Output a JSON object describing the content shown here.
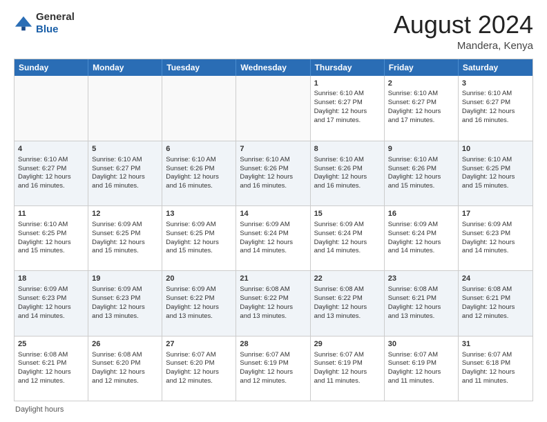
{
  "logo": {
    "general": "General",
    "blue": "Blue"
  },
  "title": "August 2024",
  "location": "Mandera, Kenya",
  "days": [
    "Sunday",
    "Monday",
    "Tuesday",
    "Wednesday",
    "Thursday",
    "Friday",
    "Saturday"
  ],
  "footer": "Daylight hours",
  "weeks": [
    [
      {
        "day": "",
        "content": ""
      },
      {
        "day": "",
        "content": ""
      },
      {
        "day": "",
        "content": ""
      },
      {
        "day": "",
        "content": ""
      },
      {
        "day": "1",
        "content": "Sunrise: 6:10 AM\nSunset: 6:27 PM\nDaylight: 12 hours\nand 17 minutes."
      },
      {
        "day": "2",
        "content": "Sunrise: 6:10 AM\nSunset: 6:27 PM\nDaylight: 12 hours\nand 17 minutes."
      },
      {
        "day": "3",
        "content": "Sunrise: 6:10 AM\nSunset: 6:27 PM\nDaylight: 12 hours\nand 16 minutes."
      }
    ],
    [
      {
        "day": "4",
        "content": "Sunrise: 6:10 AM\nSunset: 6:27 PM\nDaylight: 12 hours\nand 16 minutes."
      },
      {
        "day": "5",
        "content": "Sunrise: 6:10 AM\nSunset: 6:27 PM\nDaylight: 12 hours\nand 16 minutes."
      },
      {
        "day": "6",
        "content": "Sunrise: 6:10 AM\nSunset: 6:26 PM\nDaylight: 12 hours\nand 16 minutes."
      },
      {
        "day": "7",
        "content": "Sunrise: 6:10 AM\nSunset: 6:26 PM\nDaylight: 12 hours\nand 16 minutes."
      },
      {
        "day": "8",
        "content": "Sunrise: 6:10 AM\nSunset: 6:26 PM\nDaylight: 12 hours\nand 16 minutes."
      },
      {
        "day": "9",
        "content": "Sunrise: 6:10 AM\nSunset: 6:26 PM\nDaylight: 12 hours\nand 15 minutes."
      },
      {
        "day": "10",
        "content": "Sunrise: 6:10 AM\nSunset: 6:25 PM\nDaylight: 12 hours\nand 15 minutes."
      }
    ],
    [
      {
        "day": "11",
        "content": "Sunrise: 6:10 AM\nSunset: 6:25 PM\nDaylight: 12 hours\nand 15 minutes."
      },
      {
        "day": "12",
        "content": "Sunrise: 6:09 AM\nSunset: 6:25 PM\nDaylight: 12 hours\nand 15 minutes."
      },
      {
        "day": "13",
        "content": "Sunrise: 6:09 AM\nSunset: 6:25 PM\nDaylight: 12 hours\nand 15 minutes."
      },
      {
        "day": "14",
        "content": "Sunrise: 6:09 AM\nSunset: 6:24 PM\nDaylight: 12 hours\nand 14 minutes."
      },
      {
        "day": "15",
        "content": "Sunrise: 6:09 AM\nSunset: 6:24 PM\nDaylight: 12 hours\nand 14 minutes."
      },
      {
        "day": "16",
        "content": "Sunrise: 6:09 AM\nSunset: 6:24 PM\nDaylight: 12 hours\nand 14 minutes."
      },
      {
        "day": "17",
        "content": "Sunrise: 6:09 AM\nSunset: 6:23 PM\nDaylight: 12 hours\nand 14 minutes."
      }
    ],
    [
      {
        "day": "18",
        "content": "Sunrise: 6:09 AM\nSunset: 6:23 PM\nDaylight: 12 hours\nand 14 minutes."
      },
      {
        "day": "19",
        "content": "Sunrise: 6:09 AM\nSunset: 6:23 PM\nDaylight: 12 hours\nand 13 minutes."
      },
      {
        "day": "20",
        "content": "Sunrise: 6:09 AM\nSunset: 6:22 PM\nDaylight: 12 hours\nand 13 minutes."
      },
      {
        "day": "21",
        "content": "Sunrise: 6:08 AM\nSunset: 6:22 PM\nDaylight: 12 hours\nand 13 minutes."
      },
      {
        "day": "22",
        "content": "Sunrise: 6:08 AM\nSunset: 6:22 PM\nDaylight: 12 hours\nand 13 minutes."
      },
      {
        "day": "23",
        "content": "Sunrise: 6:08 AM\nSunset: 6:21 PM\nDaylight: 12 hours\nand 13 minutes."
      },
      {
        "day": "24",
        "content": "Sunrise: 6:08 AM\nSunset: 6:21 PM\nDaylight: 12 hours\nand 12 minutes."
      }
    ],
    [
      {
        "day": "25",
        "content": "Sunrise: 6:08 AM\nSunset: 6:21 PM\nDaylight: 12 hours\nand 12 minutes."
      },
      {
        "day": "26",
        "content": "Sunrise: 6:08 AM\nSunset: 6:20 PM\nDaylight: 12 hours\nand 12 minutes."
      },
      {
        "day": "27",
        "content": "Sunrise: 6:07 AM\nSunset: 6:20 PM\nDaylight: 12 hours\nand 12 minutes."
      },
      {
        "day": "28",
        "content": "Sunrise: 6:07 AM\nSunset: 6:19 PM\nDaylight: 12 hours\nand 12 minutes."
      },
      {
        "day": "29",
        "content": "Sunrise: 6:07 AM\nSunset: 6:19 PM\nDaylight: 12 hours\nand 11 minutes."
      },
      {
        "day": "30",
        "content": "Sunrise: 6:07 AM\nSunset: 6:19 PM\nDaylight: 12 hours\nand 11 minutes."
      },
      {
        "day": "31",
        "content": "Sunrise: 6:07 AM\nSunset: 6:18 PM\nDaylight: 12 hours\nand 11 minutes."
      }
    ]
  ]
}
